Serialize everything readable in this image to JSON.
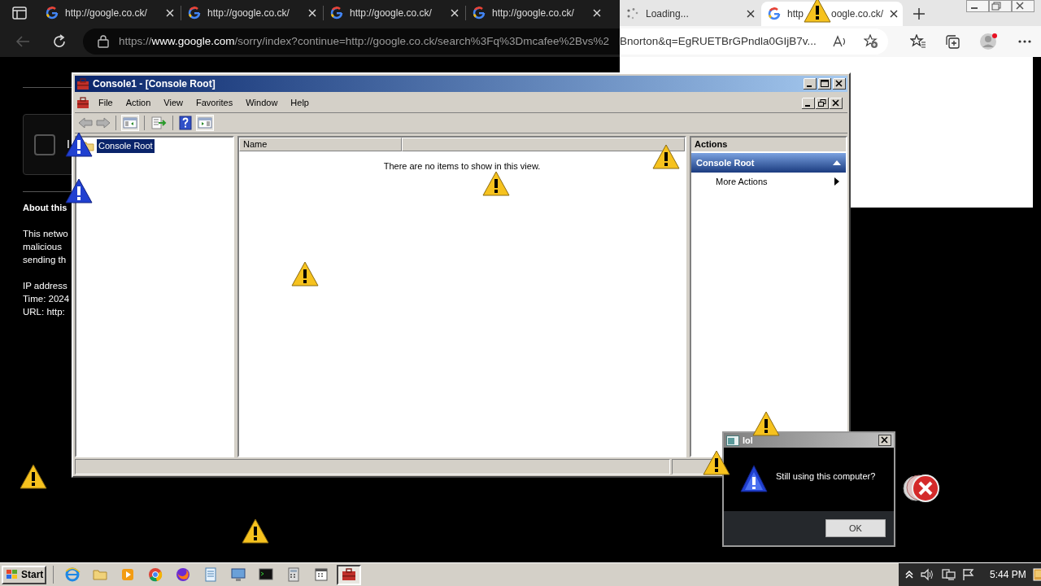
{
  "browser": {
    "tabs": [
      {
        "title": "http://google.co.ck/",
        "selected": false,
        "kind": "google"
      },
      {
        "title": "http://google.co.ck/",
        "selected": false,
        "kind": "google"
      },
      {
        "title": "http://google.co.ck/",
        "selected": false,
        "kind": "google"
      },
      {
        "title": "http://google.co.ck/",
        "selected": false,
        "kind": "google"
      },
      {
        "title": "Loading...",
        "selected": false,
        "kind": "loading"
      },
      {
        "title": "http",
        "title_rest": "oogle.co.ck/",
        "selected": true,
        "kind": "google"
      }
    ],
    "address": {
      "scheme": "https://",
      "host": "www.google.com",
      "path": "/sorry/index?continue=http://google.co.ck/search%3Fq%3Dmcafee%2Bvs%2",
      "path_rest": "Bnorton&q=EgRUETBrGPndla0GIjB7v..."
    }
  },
  "page": {
    "checkbox_checked": false,
    "checkbox_label": "I",
    "heading": "About this",
    "paragraph": [
      "This netwo",
      "malicious",
      "sending th"
    ],
    "details": [
      "IP address",
      "Time: 2024",
      "URL: http:"
    ]
  },
  "console": {
    "title": "Console1 - [Console Root]",
    "menu": [
      "File",
      "Action",
      "View",
      "Favorites",
      "Window",
      "Help"
    ],
    "tree": [
      {
        "label": "Console Root",
        "selected": true
      }
    ],
    "columns": [
      "Name"
    ],
    "empty_message": "There are no items to show in this view.",
    "actions": {
      "header": "Actions",
      "group": "Console Root",
      "expanded": true,
      "items": [
        "More Actions"
      ]
    }
  },
  "dialog": {
    "title": "lol",
    "message": "Still using this computer?",
    "button": "OK"
  },
  "taskbar": {
    "start": "Start",
    "clock": "5:44 PM"
  }
}
